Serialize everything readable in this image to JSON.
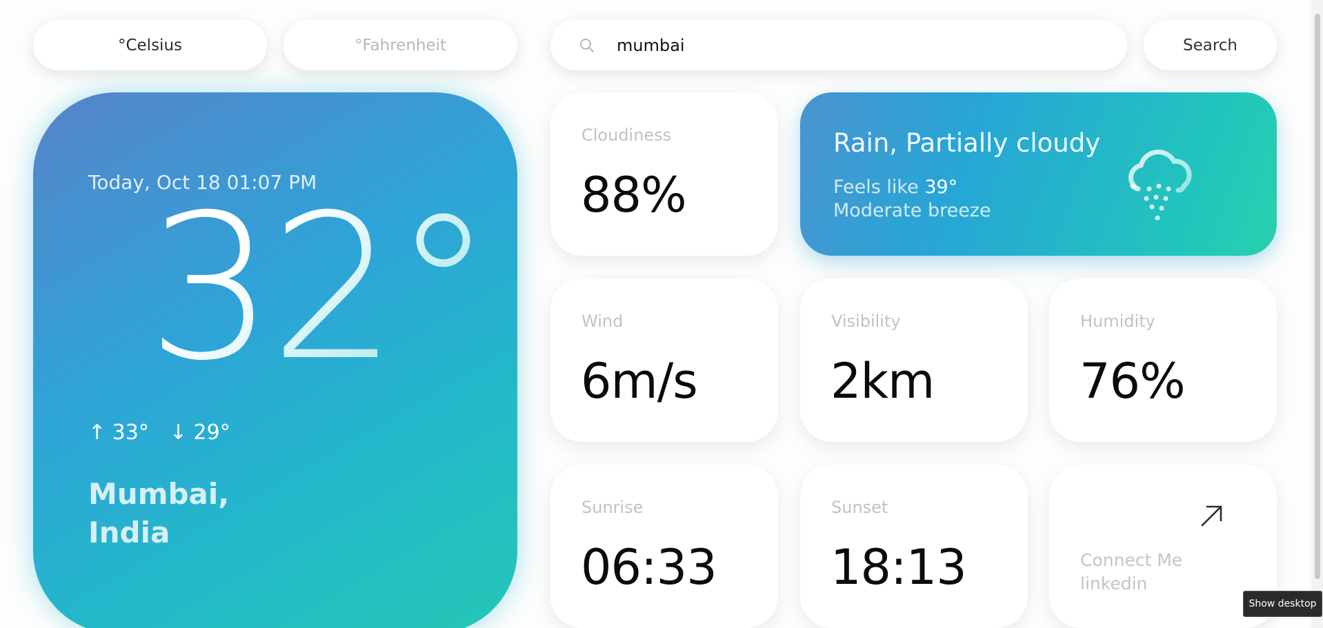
{
  "units": {
    "celsius_label": "°Celsius",
    "fahrenheit_label": "°Fahrenheit"
  },
  "search": {
    "value": "mumbai",
    "placeholder": "",
    "button_label": "Search"
  },
  "main": {
    "date": "Today, Oct 18 01:07 PM",
    "temperature": "32°",
    "high": "↑ 33°",
    "low": "↓ 29°",
    "city_line1": "Mumbai,",
    "city_line2": "India",
    "gradient": [
      "#5784c9",
      "#2fa3d8",
      "#26c7b6"
    ]
  },
  "condition": {
    "title": "Rain, Partially cloudy",
    "feels_prefix": "Feels like ",
    "feels_value": "39°",
    "breeze": "Moderate breeze",
    "icon": "rain-cloud-icon"
  },
  "stats": {
    "cloudiness": {
      "label": "Cloudiness",
      "value": "88%"
    },
    "wind": {
      "label": "Wind",
      "value": "6m/s"
    },
    "visibility": {
      "label": "Visibility",
      "value": "2km"
    },
    "humidity": {
      "label": "Humidity",
      "value": "76%"
    },
    "sunrise": {
      "label": "Sunrise",
      "value": "06:33"
    },
    "sunset": {
      "label": "Sunset",
      "value": "18:13"
    }
  },
  "connect": {
    "line1": "Connect Me",
    "line2": "linkedin",
    "icon": "arrow-up-right-icon"
  },
  "os": {
    "tooltip": "Show desktop"
  },
  "colors": {
    "accent_teal": "#26c7b6",
    "accent_blue": "#2fa3d8",
    "muted_label": "#c2c2c2"
  }
}
